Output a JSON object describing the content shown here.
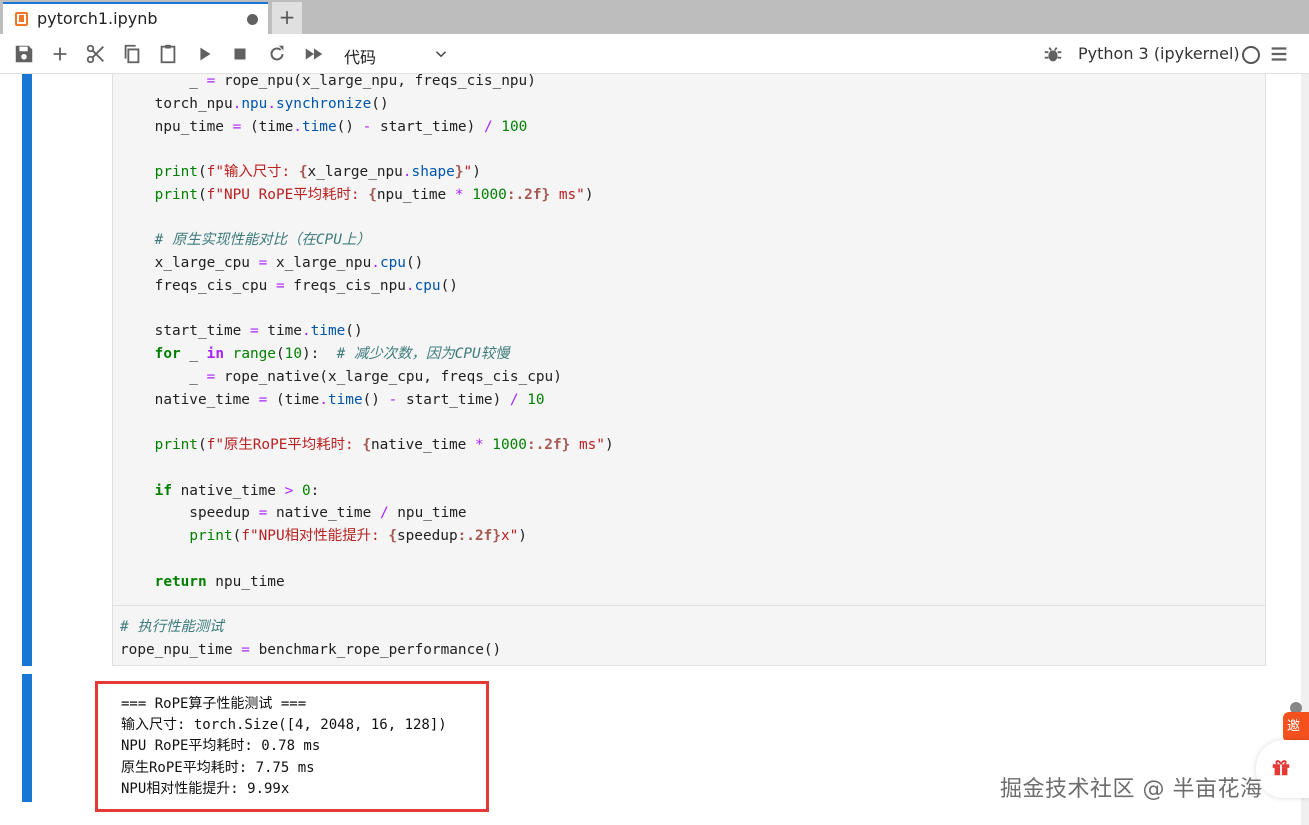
{
  "tab": {
    "title": "pytorch1.ipynb",
    "new_tab": "+"
  },
  "toolbar": {
    "cell_type": "代码",
    "kernel_name": "Python 3 (ipykernel)"
  },
  "code_lines": [
    "        _ = rope_npu(x_large_npu, freqs_cis_npu)",
    "    torch_npu.npu.synchronize()",
    "    npu_time = (time.time() - start_time) / 100",
    "",
    "    print(f\"输入尺寸: {x_large_npu.shape}\")",
    "    print(f\"NPU RoPE平均耗时: {npu_time * 1000:.2f} ms\")",
    "",
    "    # 原生实现性能对比（在CPU上）",
    "    x_large_cpu = x_large_npu.cpu()",
    "    freqs_cis_cpu = freqs_cis_npu.cpu()",
    "",
    "    start_time = time.time()",
    "    for _ in range(10):  # 减少次数，因为CPU较慢",
    "        _ = rope_native(x_large_cpu, freqs_cis_cpu)",
    "    native_time = (time.time() - start_time) / 10",
    "",
    "    print(f\"原生RoPE平均耗时: {native_time * 1000:.2f} ms\")",
    "",
    "    if native_time > 0:",
    "        speedup = native_time / npu_time",
    "        print(f\"NPU相对性能提升: {speedup:.2f}x\")",
    "",
    "    return npu_time",
    "",
    "# 执行性能测试",
    "rope_npu_time = benchmark_rope_performance()"
  ],
  "output_lines": [
    "=== RoPE算子性能测试 ===",
    "输入尺寸: torch.Size([4, 2048, 16, 128])",
    "NPU RoPE平均耗时: 0.78 ms",
    "原生RoPE平均耗时: 7.75 ms",
    "NPU相对性能提升: 9.99x"
  ],
  "side_widget": {
    "invite_label": "邀请"
  },
  "watermark": "掘金技术社区 @ 半亩花海",
  "colors": {
    "accent": "#1976d2",
    "highlight_box": "#e53935",
    "jupyter_orange": "#f37726"
  }
}
